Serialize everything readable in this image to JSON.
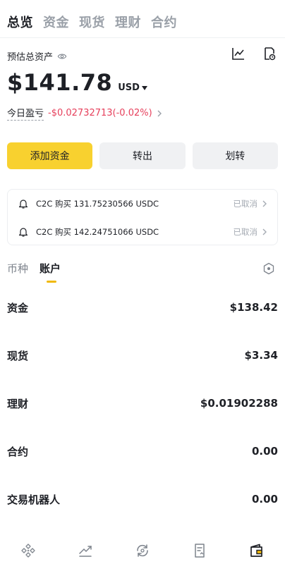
{
  "top_tabs": [
    {
      "label": "总览",
      "active": true
    },
    {
      "label": "资金",
      "active": false
    },
    {
      "label": "现货",
      "active": false
    },
    {
      "label": "理财",
      "active": false
    },
    {
      "label": "合约",
      "active": false
    }
  ],
  "overview": {
    "estimated_label": "预估总资产",
    "balance": "$141.78",
    "currency": "USD",
    "pnl_label": "今日盈亏",
    "pnl_value": "-$0.02732713(-0.02%)",
    "pnl_color": "#e63f5b"
  },
  "actions": {
    "add_funds": "添加资金",
    "withdraw": "转出",
    "transfer": "划转",
    "primary_color": "#f8d12f"
  },
  "orders": [
    {
      "text": "C2C 购买 131.75230566 USDC",
      "status": "已取消"
    },
    {
      "text": "C2C 购买 142.24751066 USDC",
      "status": "已取消"
    }
  ],
  "sub_tabs": [
    {
      "label": "币种",
      "active": false
    },
    {
      "label": "账户",
      "active": true
    }
  ],
  "accounts": [
    {
      "name": "资金",
      "value": "$138.42"
    },
    {
      "name": "现货",
      "value": "$3.34"
    },
    {
      "name": "理财",
      "value": "$0.01902288"
    },
    {
      "name": "合约",
      "value": "0.00"
    },
    {
      "name": "交易机器人",
      "value": "0.00"
    }
  ],
  "bottom_nav": [
    {
      "icon": "home-diamond-icon",
      "active": false
    },
    {
      "icon": "markets-chart-icon",
      "active": false
    },
    {
      "icon": "trade-swap-icon",
      "active": false
    },
    {
      "icon": "orders-document-icon",
      "active": false
    },
    {
      "icon": "wallet-icon",
      "active": true
    }
  ]
}
